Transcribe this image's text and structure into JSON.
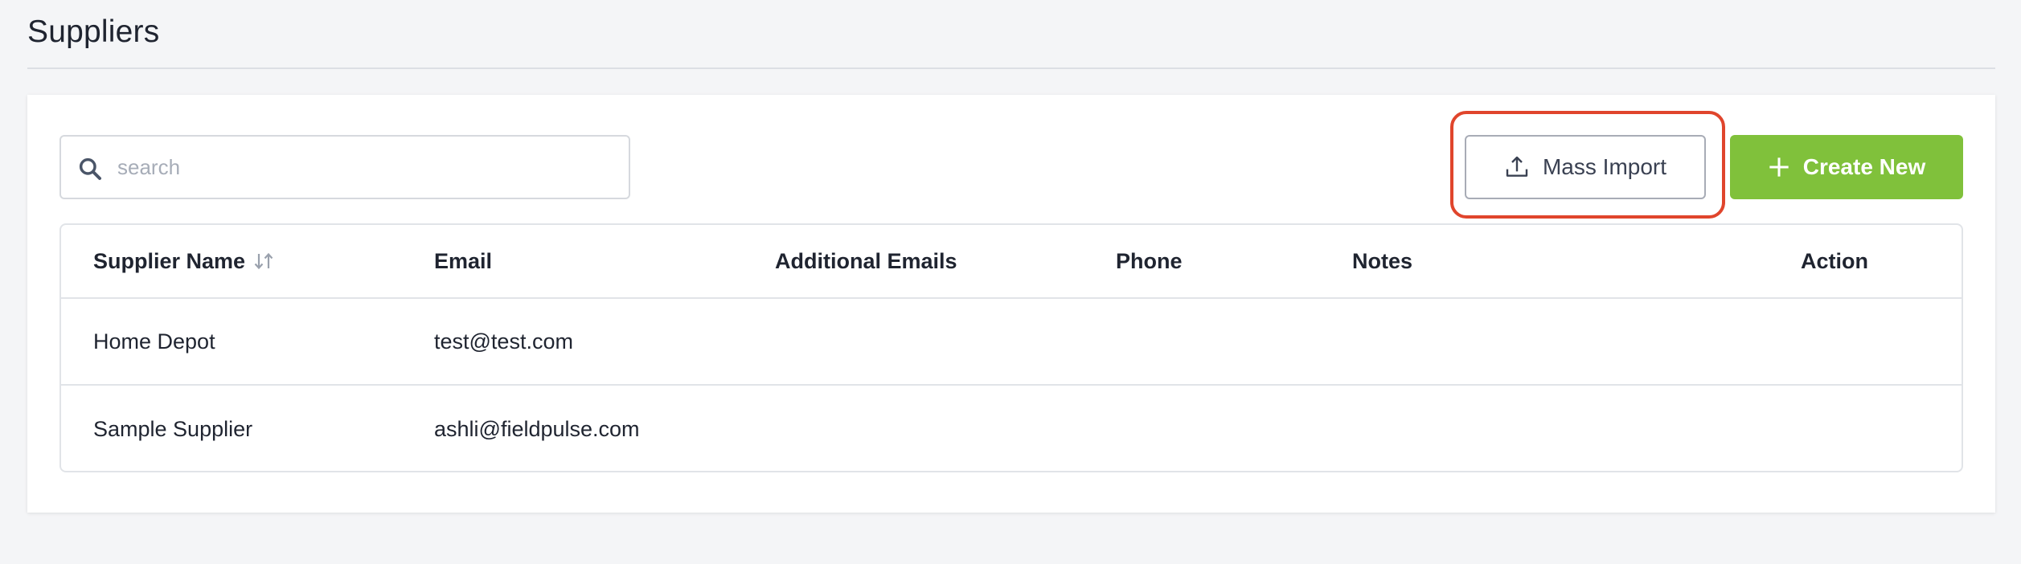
{
  "page": {
    "title": "Suppliers"
  },
  "toolbar": {
    "search_placeholder": "search",
    "search_value": "",
    "mass_import_label": "Mass Import",
    "create_new_label": "Create New"
  },
  "table": {
    "columns": [
      "Supplier Name",
      "Email",
      "Additional Emails",
      "Phone",
      "Notes",
      "Action"
    ],
    "rows": [
      {
        "supplier_name": "Home Depot",
        "email": "test@test.com",
        "additional_emails": "",
        "phone": "",
        "notes": "",
        "action": ""
      },
      {
        "supplier_name": "Sample Supplier",
        "email": "ashli@fieldpulse.com",
        "additional_emails": "",
        "phone": "",
        "notes": "",
        "action": ""
      }
    ]
  },
  "icons": {
    "search": "search-icon",
    "upload": "upload-icon",
    "plus": "plus-icon",
    "sort": "sort-icon"
  },
  "colors": {
    "accent_green": "#80c13b",
    "highlight_red": "#e0452c",
    "page_bg": "#f4f5f7"
  }
}
